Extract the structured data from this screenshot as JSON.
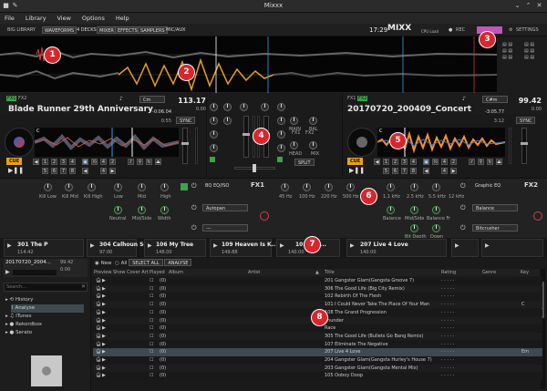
{
  "window": {
    "title": "Mixxx"
  },
  "menu": [
    "File",
    "Library",
    "View",
    "Options",
    "Help"
  ],
  "toolbar": {
    "big_library": "BIG LIBRARY",
    "buttons": [
      "WAVEFORMS",
      "4 DECKS",
      "MIXER",
      "EFFECTS",
      "SAMPLERS",
      "MIC/AUX"
    ],
    "clock": "17:29",
    "logo": "MIXX",
    "cpu_load": "CPU Load",
    "rec": "REC",
    "settings": "SETTINGS"
  },
  "callouts": [
    "1",
    "2",
    "3",
    "4",
    "5",
    "6",
    "7",
    "8"
  ],
  "deck1": {
    "fx": "FX1",
    "fx2": "FX2",
    "title": "Blade Runner 29th Anniversary Limi...",
    "key": "Cm",
    "bpm": "113.17",
    "rate": "0.00",
    "time": "-0:06.04",
    "time2": "0:55",
    "sync": "SYNC",
    "cue": "CUE",
    "hotcues": [
      "1",
      "2",
      "3",
      "4",
      "5",
      "6",
      "7",
      "8"
    ]
  },
  "deck2": {
    "fx": "FX1",
    "fx2": "FX2",
    "title": "20170720_200409_Concert",
    "key": "C#m",
    "bpm": "99.42",
    "rate": "0.00",
    "time": "-3:05.77",
    "time2": "3:12",
    "sync": "SYNC",
    "cue": "CUE",
    "hotcues": [
      "1",
      "2",
      "3",
      "4",
      "5",
      "6",
      "7",
      "8"
    ]
  },
  "mixer": {
    "main": "MAIN",
    "bal": "BAL",
    "head": "HEAD",
    "mix": "MIX",
    "split": "SPLIT",
    "fx1": "FX1",
    "fx2": "FX2"
  },
  "effects": {
    "left": {
      "labels": [
        "Kill Low",
        "Kill Mid",
        "Kill High",
        "Low",
        "Mid",
        "High",
        "Neutral",
        "Mid/Side",
        "Width"
      ],
      "unit1": "BQ EQ/ISO",
      "unit2": "Autopan",
      "unit3": "---",
      "fx": "FX1"
    },
    "right": {
      "labels": [
        "45 Hz",
        "100 Hz",
        "220 Hz",
        "500 Hz",
        "1.1 kHz",
        "2.5 kHz",
        "5.5 kHz",
        "12 kHz",
        "Balance",
        "Mid/Side",
        "Balance Fr",
        "Bit Depth",
        "Down"
      ],
      "unit1": "Graphic EQ",
      "unit2": "Balance",
      "unit3": "Bitcrusher",
      "fx": "FX2"
    }
  },
  "previews": [
    {
      "title": "301 The P",
      "bpm": "114.42"
    },
    {
      "title": "304 Calhoun Sq...",
      "bpm": "97.00"
    },
    {
      "title": "106 My Tree",
      "bpm": "148.00"
    },
    {
      "title": "109 Heaven Is K...",
      "bpm": "149.88"
    },
    {
      "title": "101 Nev...",
      "bpm": "140.00"
    },
    {
      "title": "207 Live 4 Love",
      "bpm": "140.00"
    }
  ],
  "minideck": {
    "title": "20170720_2004...",
    "bpm": "99.42",
    "rate": "0.00"
  },
  "library": {
    "search_placeholder": "Search...",
    "tree": [
      "History",
      "Analyse",
      "iTunes",
      "Rekordbox",
      "Serato"
    ],
    "filters": {
      "new": "New",
      "all": "All",
      "select_all": "SELECT ALL",
      "analyse": "ANALYSE"
    },
    "columns": [
      "Preview",
      "Show Cover Art",
      "Played",
      "Album",
      "Artist",
      "Title",
      "Rating",
      "Genre",
      "Key"
    ],
    "rows": [
      {
        "album": "(0)",
        "title": "201 Gangster Glam(Gangsta Groove 7)",
        "key": ""
      },
      {
        "album": "(0)",
        "title": "306 The Good Life (Big City Remix)",
        "key": ""
      },
      {
        "album": "(0)",
        "title": "102 Rebirth Of The Flesh",
        "key": ""
      },
      {
        "album": "(0)",
        "title": "101 I Could Never Take The Place Of Your Man",
        "key": "C"
      },
      {
        "album": "(0)",
        "title": "108 The Grand Progression",
        "key": ""
      },
      {
        "album": "(0)",
        "title": "Thunder",
        "key": ""
      },
      {
        "album": "(0)",
        "title": "Race",
        "key": ""
      },
      {
        "album": "(0)",
        "title": "305 The Good Life (Bullets Go Bang Remix)",
        "key": ""
      },
      {
        "album": "(0)",
        "title": "107 Eliminate The Negative",
        "key": ""
      },
      {
        "album": "(0)",
        "title": "207 Live 4 Love",
        "key": "Em"
      },
      {
        "album": "(0)",
        "title": "204 Gangster Glam(Gangsta Hurley's House 7)",
        "key": ""
      },
      {
        "album": "(0)",
        "title": "203 Gangster Glam(Gangsta Mental Mix)",
        "key": ""
      },
      {
        "album": "(0)",
        "title": "105 Ooboy Doop",
        "key": ""
      }
    ]
  },
  "colors": {
    "accent": "#3aa548",
    "deck1_wave": "#e8a020",
    "deck2_wave": "#ff9030",
    "callout": "#d8262c",
    "cue": "#e8a020"
  }
}
